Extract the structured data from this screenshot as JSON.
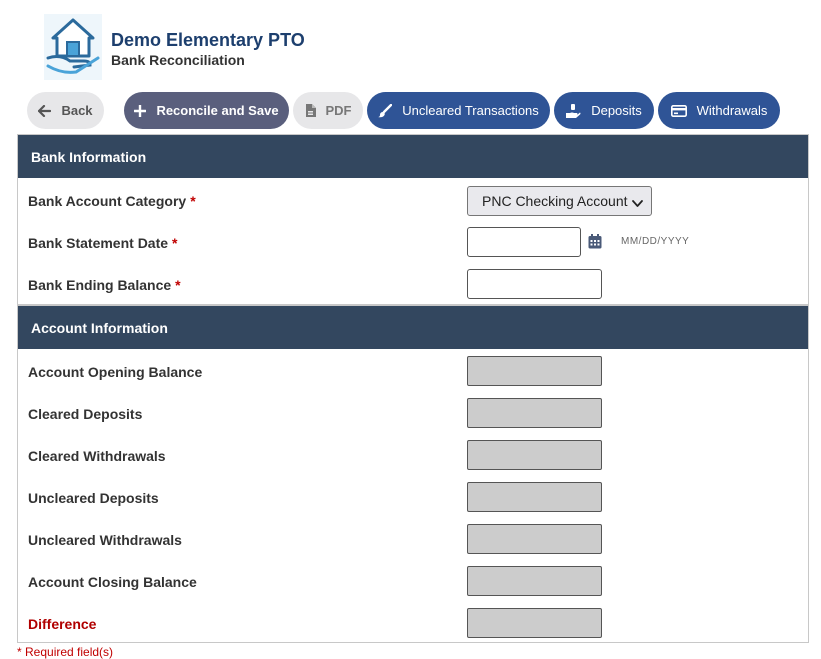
{
  "header": {
    "org_title": "Demo Elementary PTO",
    "page_subtitle": "Bank Reconciliation",
    "logo_icon": "house-hand-icon"
  },
  "toolbar": {
    "back_label": "Back",
    "reconcile_label": "Reconcile and Save",
    "pdf_label": "PDF",
    "uncleared_label": "Uncleared Transactions",
    "deposits_label": "Deposits",
    "withdrawals_label": "Withdrawals"
  },
  "bank_info": {
    "title": "Bank Information",
    "category_label": "Bank Account Category",
    "category_value": "PNC Checking Account",
    "statement_date_label": "Bank Statement Date",
    "statement_date_value": "",
    "date_format_hint": "MM/DD/YYYY",
    "ending_balance_label": "Bank Ending Balance",
    "ending_balance_value": "",
    "required_mark": "*"
  },
  "account_info": {
    "title": "Account Information",
    "rows": [
      {
        "label": "Account Opening Balance",
        "value": ""
      },
      {
        "label": "Cleared Deposits",
        "value": ""
      },
      {
        "label": "Cleared Withdrawals",
        "value": ""
      },
      {
        "label": "Uncleared Deposits",
        "value": ""
      },
      {
        "label": "Uncleared Withdrawals",
        "value": ""
      },
      {
        "label": "Account Closing Balance",
        "value": ""
      },
      {
        "label": "Difference",
        "value": ""
      }
    ]
  },
  "footnote": "* Required field(s)",
  "colors": {
    "panel_header": "#33475f",
    "primary_button": "#2f5496",
    "reconcile_button": "#5a5f7d",
    "required": "#c00000",
    "title": "#1d3f6e"
  }
}
